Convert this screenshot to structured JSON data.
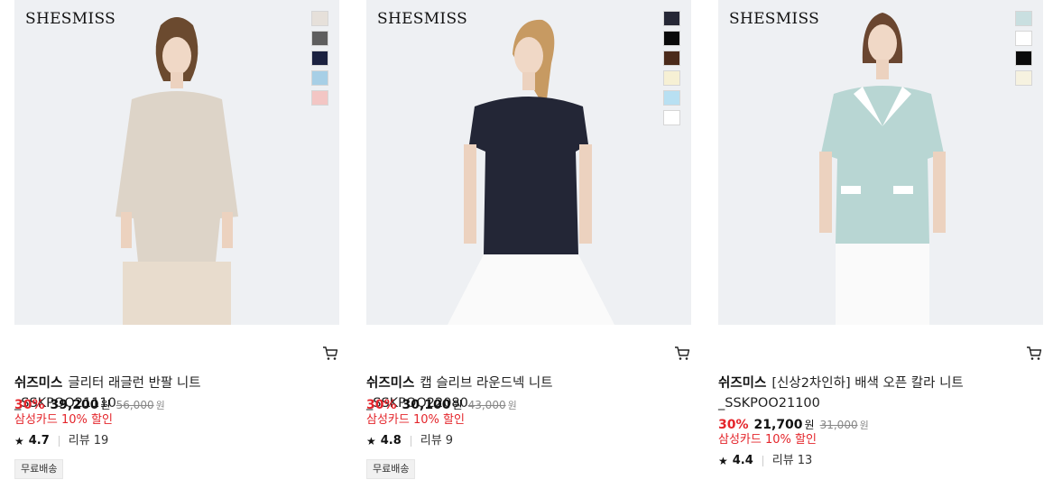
{
  "products": [
    {
      "logo": "SHESMISS",
      "colors": [
        "#e6e0da",
        "#5e5e5e",
        "#1c2240",
        "#a7cfe6",
        "#f3c6c4"
      ],
      "brand": "쉬즈미스",
      "name": "글리터 래글런 반팔 니트_SSKPOO21110",
      "discount": "30%",
      "price": "39,200",
      "currency": "원",
      "original_price": "56,000",
      "original_currency": "원",
      "card_discount": "삼성카드 10% 할인",
      "rating": "4.7",
      "review_label": "리뷰",
      "review_count": "19",
      "shipping_badge": "무료배송"
    },
    {
      "logo": "SHESMISS",
      "colors": [
        "#262836",
        "#0a0a0a",
        "#4a2a1a",
        "#f6f0d4",
        "#b8e0f2",
        "#ffffff"
      ],
      "brand": "쉬즈미스",
      "name": "캡 슬리브 라운드넥 니트_SSKPOO22080",
      "discount": "30%",
      "price": "30,100",
      "currency": "원",
      "original_price": "43,000",
      "original_currency": "원",
      "card_discount": "삼성카드 10% 할인",
      "rating": "4.8",
      "review_label": "리뷰",
      "review_count": "9",
      "shipping_badge": "무료배송"
    },
    {
      "logo": "SHESMISS",
      "colors": [
        "#c9dfe0",
        "#ffffff",
        "#0a0a0a",
        "#f6f2e0"
      ],
      "brand": "쉬즈미스",
      "name": "[신상2차인하] 배색 오픈 칼라 니트 _SSKPOO21100",
      "discount": "30%",
      "price": "21,700",
      "currency": "원",
      "original_price": "31,000",
      "original_currency": "원",
      "card_discount": "삼성카드 10% 할인",
      "rating": "4.4",
      "review_label": "리뷰",
      "review_count": "13",
      "shipping_badge": null
    }
  ],
  "icons": {
    "cart": "cart-icon",
    "star": "star-icon"
  },
  "colors": {
    "accent_red": "#e4252b",
    "photo_bg": "#eef0f3"
  }
}
